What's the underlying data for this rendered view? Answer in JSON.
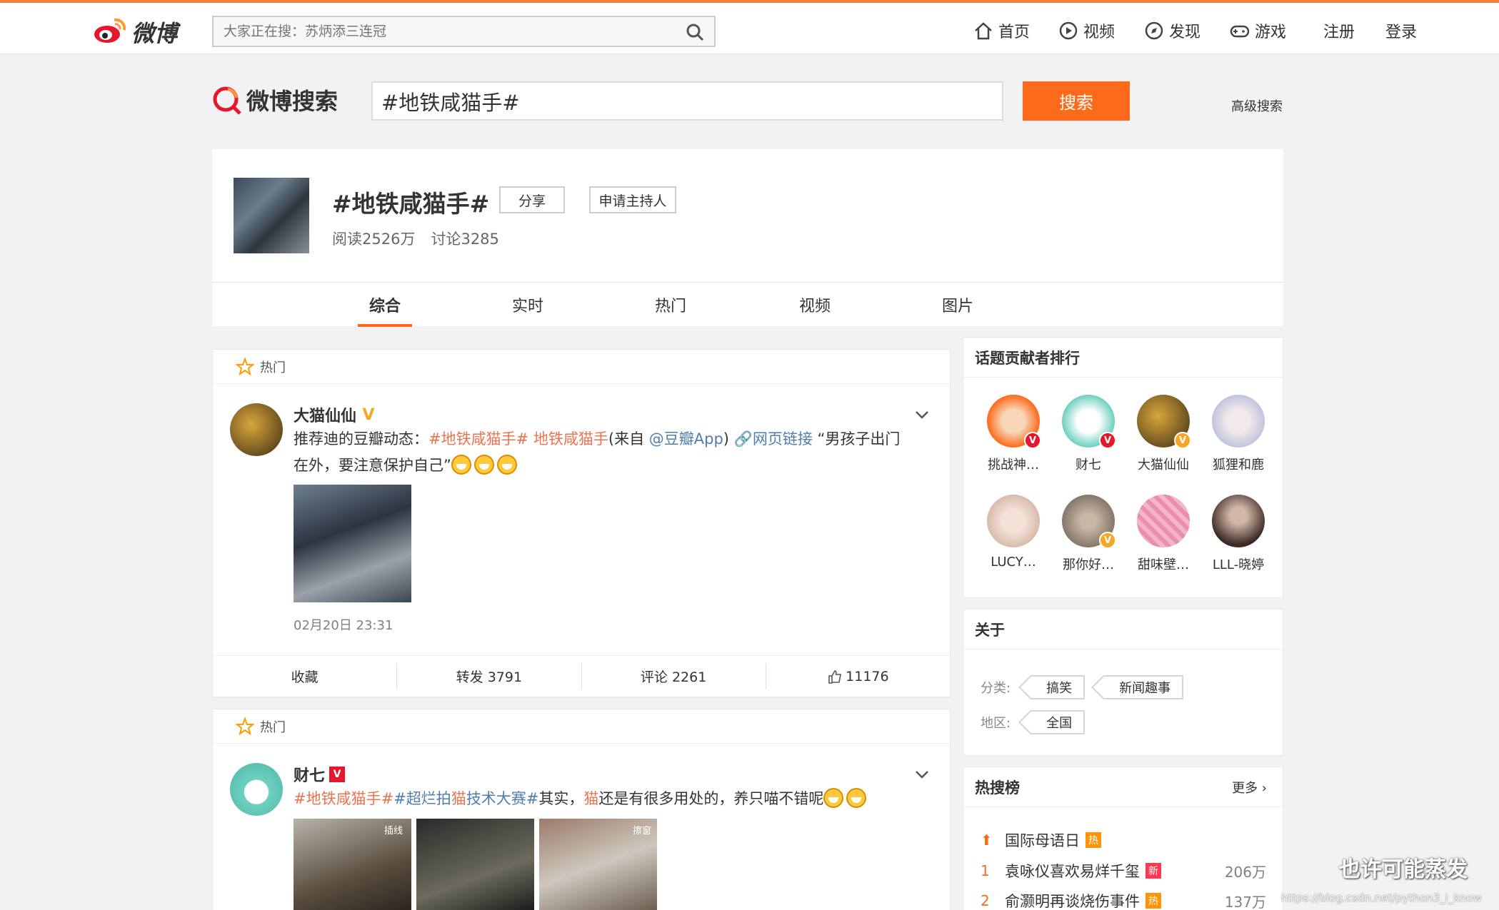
{
  "topbar": {
    "logo_text": "微博",
    "search_placeholder": "大家正在搜：苏炳添三连冠",
    "nav": [
      "首页",
      "视频",
      "发现",
      "游戏",
      "注册",
      "登录"
    ]
  },
  "search": {
    "brand": "微博搜索",
    "query": "#地铁咸猫手#",
    "button": "搜索",
    "advanced": "高级搜索"
  },
  "topic": {
    "title": "#地铁咸猫手#",
    "share": "分享",
    "apply_host": "申请主持人",
    "reads": "阅读2526万",
    "discussions": "讨论3285"
  },
  "tabs": [
    "综合",
    "实时",
    "热门",
    "视频",
    "图片"
  ],
  "posts": [
    {
      "hot_label": "热门",
      "user": "大猫仙仙",
      "text_prefix": "推荐迪的豆瓣动态：",
      "tag1": "#地铁咸猫手#",
      "tag2": " 地铁咸猫手",
      "from_prefix": "(来自 ",
      "from_link": "@豆瓣App",
      "from_suffix": ")",
      "web_link": "网页链接",
      "quote": " “男孩子出门在外，要注意保护自己”",
      "time": "02月20日 23:31",
      "actions": [
        "收藏",
        "转发 3791",
        "评论 2261",
        "11176"
      ]
    },
    {
      "hot_label": "热门",
      "user": "财七",
      "tag1": "#地铁咸猫手#",
      "tag2": "#超烂拍",
      "tag2_kw": "猫",
      "tag2_end": "技术大赛#",
      "mid": "其实，",
      "kw": "猫",
      "rest": "还是有很多用处的，养只喵不错呢",
      "img_labels": [
        "插线",
        "",
        "擦窗"
      ]
    }
  ],
  "sidebar": {
    "contributors_title": "话题贡献者排行",
    "contributors": [
      "挑战神…",
      "财七",
      "大猫仙仙",
      "狐狸和鹿",
      "LUCY…",
      "那你好…",
      "甜味壁…",
      "LLL-晓婷"
    ],
    "about_title": "关于",
    "category_label": "分类:",
    "categories": [
      "搞笑",
      "新闻趣事"
    ],
    "region_label": "地区:",
    "regions": [
      "全国"
    ],
    "hot_title": "热搜榜",
    "more": "更多",
    "hot_list": [
      {
        "rank": "",
        "title": "国际母语日",
        "mark": "热",
        "count": ""
      },
      {
        "rank": "1",
        "title": "袁咏仪喜欢易烊千玺",
        "mark": "新",
        "count": "206万"
      },
      {
        "rank": "2",
        "title": "俞灏明再谈烧伤事件",
        "mark": "热",
        "count": "137万"
      }
    ]
  },
  "colors": {
    "accent": "#ff6a1a",
    "tag": "#eb7350",
    "link": "#507daf",
    "hot_mark": "#ff9406",
    "new_mark": "#ff3852"
  },
  "watermark": {
    "text": "也许可能蒸发",
    "url": "https://blog.csdn.net/python3_i_know"
  }
}
